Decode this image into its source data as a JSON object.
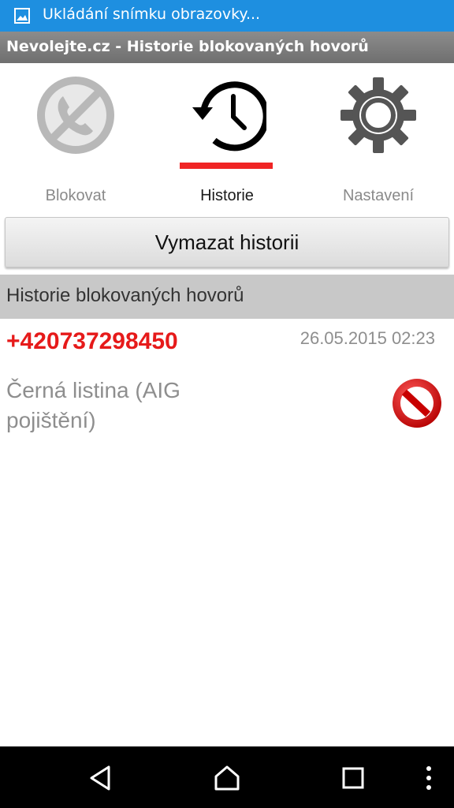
{
  "status_bar": {
    "text": "Ukládání snímku obrazovky...",
    "icon": "image-icon",
    "color": "#1e8fe0"
  },
  "title_bar": {
    "title": "Nevolejte.cz - Historie blokovaných hovorů"
  },
  "tabs": [
    {
      "label": "Blokovat",
      "icon": "blocked-phone-icon",
      "active": false
    },
    {
      "label": "Historie",
      "icon": "history-clock-icon",
      "active": true
    },
    {
      "label": "Nastavení",
      "icon": "gear-icon",
      "active": false
    }
  ],
  "accent_color": "#f02525",
  "clear_button": {
    "label": "Vymazat historii"
  },
  "section": {
    "title": "Historie blokovaných hovorů"
  },
  "history": [
    {
      "number": "+420737298450",
      "datetime": "26.05.2015 02:23",
      "reason": "Černá listina (AIG pojištění)",
      "icon": "no-entry-icon"
    }
  ],
  "nav_bar": {
    "buttons": [
      "back-icon",
      "home-icon",
      "recents-icon",
      "more-icon"
    ]
  }
}
